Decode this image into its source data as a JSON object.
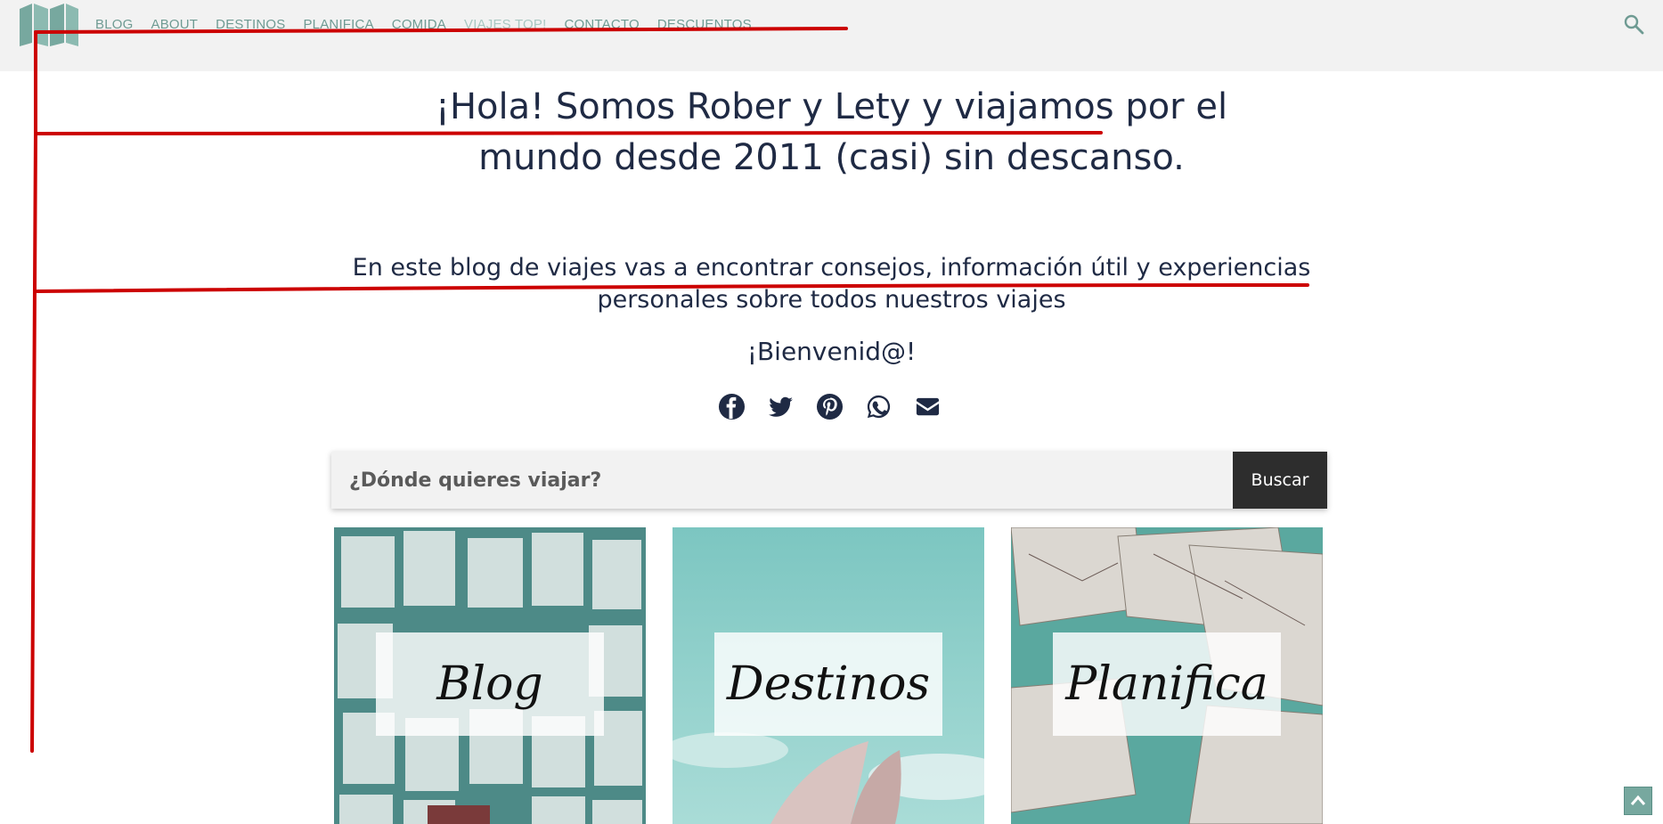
{
  "header": {
    "nav": [
      "BLOG",
      "ABOUT",
      "DESTINOS",
      "PLANIFICA",
      "COMIDA",
      "VIAJES TOP!",
      "CONTACTO",
      "DESCUENTOS"
    ]
  },
  "hero": {
    "title_line1": "¡Hola! Somos Rober y Lety y viajamos por el",
    "title_line2": "mundo desde 2011 (casi) sin descanso.",
    "sub_line1": "En este blog de viajes vas a encontrar consejos, información útil y experiencias",
    "sub_line2": "personales sobre todos nuestros viajes",
    "welcome": "¡Bienvenid@!"
  },
  "social": [
    "facebook-icon",
    "twitter-icon",
    "pinterest-icon",
    "whatsapp-icon",
    "email-icon"
  ],
  "search": {
    "placeholder": "¿Dónde quieres viajar?",
    "button": "Buscar"
  },
  "cards": [
    {
      "label": "Blog"
    },
    {
      "label": "Destinos"
    },
    {
      "label": "Planifica"
    }
  ],
  "colors": {
    "accent": "#6f9b93",
    "text": "#1f2a44",
    "annotation": "#cc0000"
  }
}
